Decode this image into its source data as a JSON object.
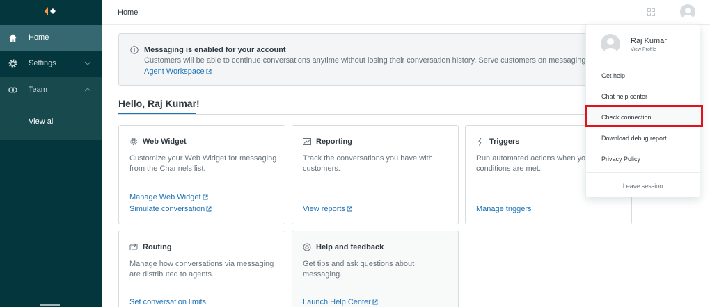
{
  "sidebar": {
    "items": [
      {
        "label": "Home",
        "icon": "home-icon"
      },
      {
        "label": "Settings",
        "icon": "gear-icon"
      },
      {
        "label": "Team",
        "icon": "team-icon"
      }
    ],
    "sub_items": [
      {
        "label": "View all"
      }
    ]
  },
  "header": {
    "title": "Home"
  },
  "banner": {
    "title": "Messaging is enabled for your account",
    "text": "Customers will be able to continue conversations anytime without losing their conversation history. Serve customers on messaging in Agent",
    "link": "Agent Workspace"
  },
  "greeting": "Hello, Raj Kumar!",
  "cards": [
    {
      "title": "Web Widget",
      "icon": "gear-icon",
      "desc": "Customize your Web Widget for messaging from the Channels list.",
      "links": [
        "Manage Web Widget",
        "Simulate conversation"
      ]
    },
    {
      "title": "Reporting",
      "icon": "chart-icon",
      "desc": "Track the conversations you have with customers.",
      "links": [
        "View reports"
      ]
    },
    {
      "title": "Triggers",
      "icon": "lightning-icon",
      "desc": "Run automated actions when your conditions are met.",
      "links": [
        "Manage triggers"
      ]
    },
    {
      "title": "Routing",
      "icon": "routing-icon",
      "desc": "Manage how conversations via messaging are distributed to agents.",
      "links": [
        "Set conversation limits"
      ]
    },
    {
      "title": "Help and feedback",
      "icon": "lifebuoy-icon",
      "desc": "Get tips and ask questions about messaging.",
      "links": [
        "Launch Help Center"
      ]
    }
  ],
  "profile_menu": {
    "name": "Raj Kumar",
    "view_profile": "View Profile",
    "items": [
      "Get help",
      "Chat help center",
      "Check connection",
      "Download debug report",
      "Privacy Policy"
    ],
    "leave": "Leave session"
  },
  "colors": {
    "sidebar": "#03363d",
    "active": "#356870",
    "link": "#1f73b7",
    "highlight": "#e1111e"
  }
}
